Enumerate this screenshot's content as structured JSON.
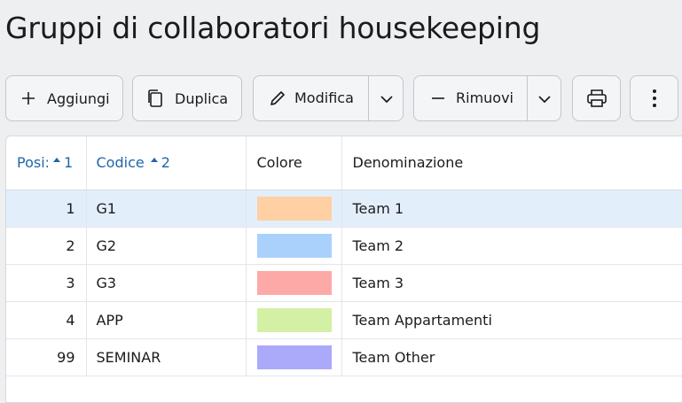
{
  "page": {
    "title": "Gruppi di collaboratori housekeeping"
  },
  "toolbar": {
    "add_label": "Aggiungi",
    "duplicate_label": "Duplica",
    "edit_label": "Modifica",
    "remove_label": "Rimuovi"
  },
  "icons": {
    "add": "plus-icon",
    "duplicate": "copy-icon",
    "edit": "pencil-icon",
    "remove": "minus-icon",
    "dropdown": "chevron-down-icon",
    "print": "printer-icon",
    "more": "more-vertical-icon"
  },
  "grid": {
    "columns": [
      {
        "label": "Posi:",
        "sort_order": "1",
        "sorted": true
      },
      {
        "label": "Codice",
        "sort_order": "2",
        "sorted": true
      },
      {
        "label": "Colore",
        "sort_order": "",
        "sorted": false
      },
      {
        "label": "Denominazione",
        "sort_order": "",
        "sorted": false
      }
    ],
    "rows": [
      {
        "position": "1",
        "code": "G1",
        "color": "#ffd0a3",
        "name": "Team 1",
        "selected": true
      },
      {
        "position": "2",
        "code": "G2",
        "color": "#a9d1fb",
        "name": "Team 2",
        "selected": false
      },
      {
        "position": "3",
        "code": "G3",
        "color": "#fca9a8",
        "name": "Team 3",
        "selected": false
      },
      {
        "position": "4",
        "code": "APP",
        "color": "#d3f0a5",
        "name": "Team Appartamenti",
        "selected": false
      },
      {
        "position": "99",
        "code": "SEMINAR",
        "color": "#aba9fa",
        "name": "Team Other",
        "selected": false
      }
    ]
  },
  "colors": {
    "accent": "#1f66a8",
    "selected_row": "#e3eefb",
    "page_background": "#eeeff1"
  }
}
